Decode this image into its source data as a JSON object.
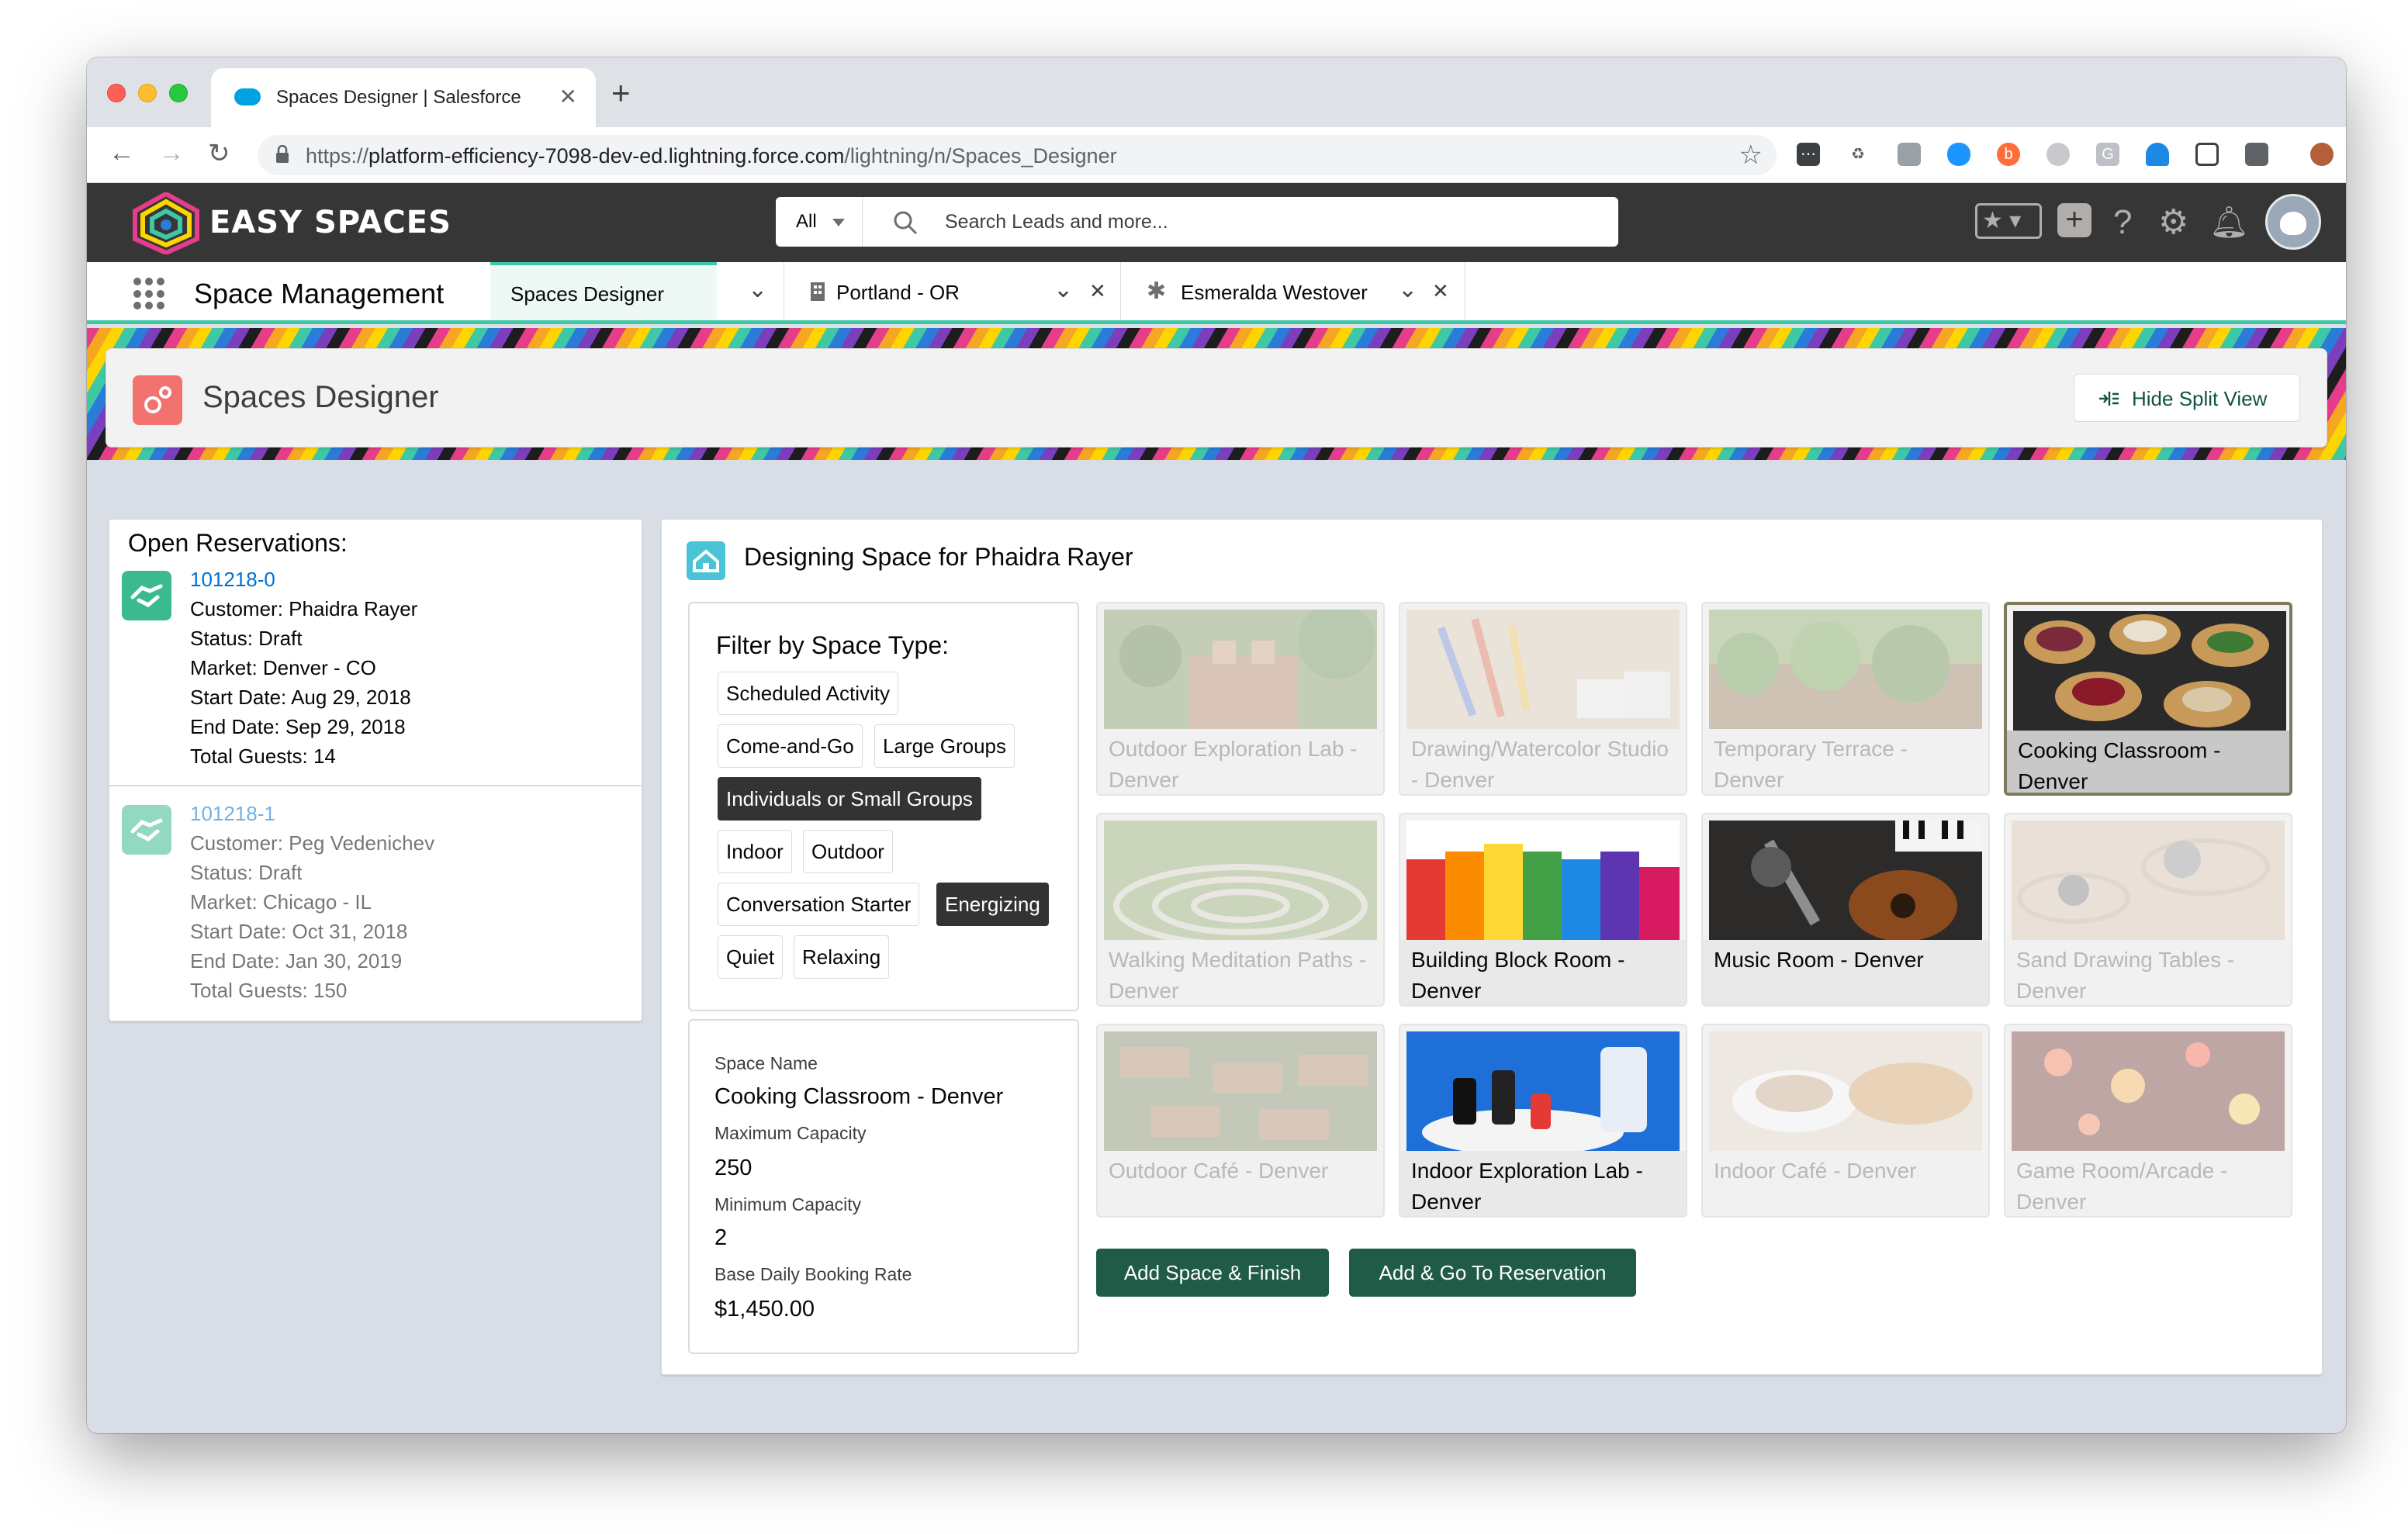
{
  "browser": {
    "tab_title": "Spaces Designer | Salesforce",
    "tab_close": "✕",
    "new_tab": "+",
    "url_prefix": "https://",
    "url_host": "platform-efficiency-7098-dev-ed.lightning.force.com",
    "url_path": "/lightning/n/Spaces_Designer"
  },
  "header": {
    "brand": "EASY SPACES",
    "search_scope": "All",
    "search_placeholder": "Search Leads and more..."
  },
  "nav": {
    "app_name": "Space Management",
    "tabs": [
      {
        "label": "Spaces Designer"
      },
      {
        "label": "Portland - OR"
      },
      {
        "label": "Esmeralda Westover"
      }
    ]
  },
  "page": {
    "title": "Spaces Designer",
    "hide_split_view": "Hide Split View"
  },
  "reservations": {
    "title": "Open Reservations:",
    "items": [
      {
        "id": "101218-0",
        "customer": "Customer: Phaidra Rayer",
        "status": "Status: Draft",
        "market": "Market: Denver - CO",
        "start": "Start Date: Aug 29, 2018",
        "end": "End Date: Sep 29, 2018",
        "guests": "Total Guests: 14"
      },
      {
        "id": "101218-1",
        "customer": "Customer: Peg Vedenichev",
        "status": "Status: Draft",
        "market": "Market: Chicago - IL",
        "start": "Start Date: Oct 31, 2018",
        "end": "End Date: Jan 30, 2019",
        "guests": "Total Guests: 150"
      }
    ]
  },
  "designer": {
    "title": "Designing Space for Phaidra Rayer",
    "filter_title": "Filter by Space Type:",
    "filters": [
      {
        "label": "Scheduled Activity",
        "selected": false
      },
      {
        "label": "Come-and-Go",
        "selected": false
      },
      {
        "label": "Large Groups",
        "selected": false
      },
      {
        "label": "Individuals or Small Groups",
        "selected": true
      },
      {
        "label": "Indoor",
        "selected": false
      },
      {
        "label": "Outdoor",
        "selected": false
      },
      {
        "label": "Conversation Starter",
        "selected": false
      },
      {
        "label": "Energizing",
        "selected": true
      },
      {
        "label": "Quiet",
        "selected": false
      },
      {
        "label": "Relaxing",
        "selected": false
      }
    ],
    "details": {
      "name_label": "Space Name",
      "name_value": "Cooking Classroom - Denver",
      "max_label": "Maximum Capacity",
      "max_value": "250",
      "min_label": "Minimum Capacity",
      "min_value": "2",
      "rate_label": "Base Daily Booking Rate",
      "rate_value": "$1,450.00"
    },
    "spaces": [
      {
        "name": "Outdoor Exploration Lab - Denver",
        "state": "dim",
        "image": "plants-pots"
      },
      {
        "name": "Drawing/Watercolor Studio - Denver",
        "state": "dim",
        "image": "paint-brushes"
      },
      {
        "name": "Temporary Terrace - Denver",
        "state": "dim",
        "image": "herb-garden"
      },
      {
        "name": "Cooking Classroom - Denver",
        "state": "selected",
        "image": "crostini"
      },
      {
        "name": "Walking Meditation Paths - Denver",
        "state": "dim",
        "image": "stone-labyrinth"
      },
      {
        "name": "Building Block Room - Denver",
        "state": "active",
        "image": "rainbow-blocks"
      },
      {
        "name": "Music Room - Denver",
        "state": "active",
        "image": "guitar-instruments"
      },
      {
        "name": "Sand Drawing Tables - Denver",
        "state": "dim",
        "image": "zen-sand"
      },
      {
        "name": "Outdoor Café - Denver",
        "state": "dim",
        "image": "cafe-tables"
      },
      {
        "name": "Indoor Exploration Lab - Denver",
        "state": "active",
        "image": "lab-bottles"
      },
      {
        "name": "Indoor Café - Denver",
        "state": "dim",
        "image": "coffee-croissant"
      },
      {
        "name": "Game Room/Arcade - Denver",
        "state": "dim",
        "image": "arcade-lights"
      }
    ],
    "btn_finish": "Add Space & Finish",
    "btn_reservation": "Add & Go To Reservation"
  },
  "colors": {
    "header_bg": "#363636",
    "accent": "#3ec8a6",
    "button": "#1f5b46",
    "link": "#0070d2"
  }
}
